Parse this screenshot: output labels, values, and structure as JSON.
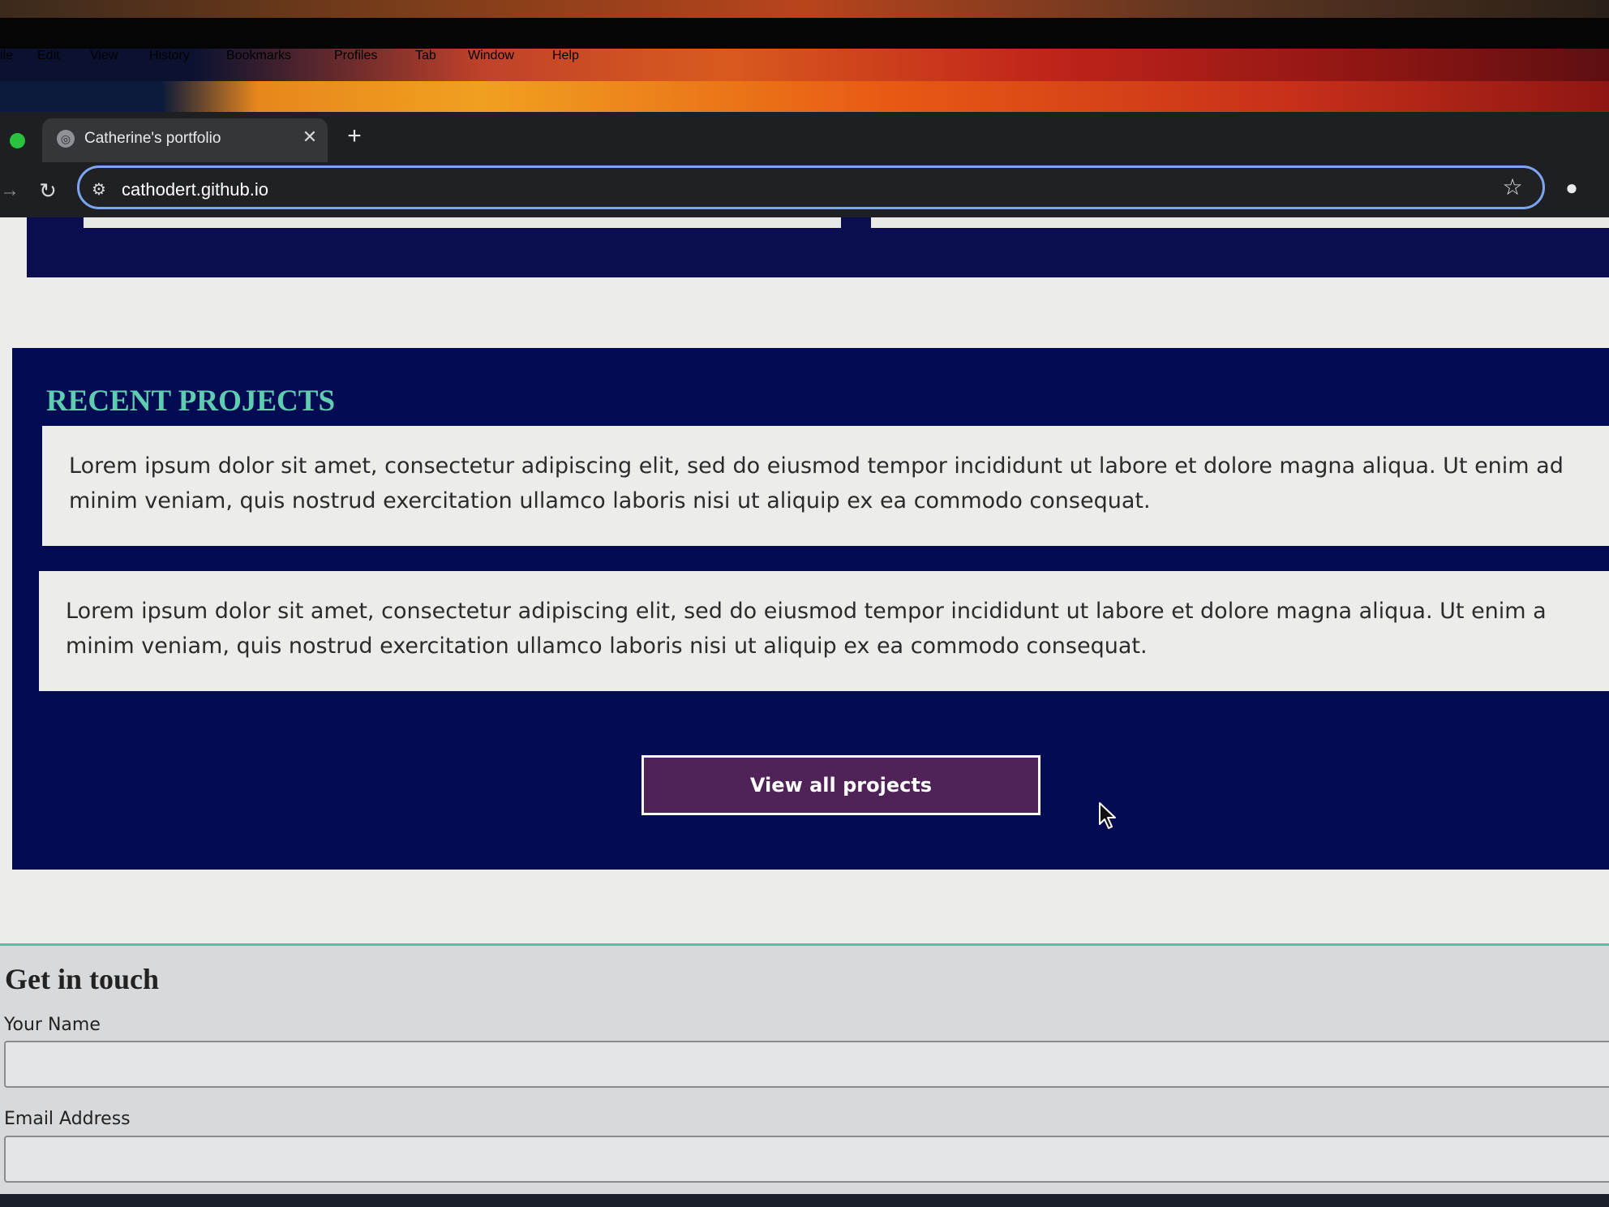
{
  "menubar": {
    "items": [
      "ile",
      "Edit",
      "View",
      "History",
      "Bookmarks",
      "Profiles",
      "Tab",
      "Window",
      "Help"
    ]
  },
  "browser": {
    "tab_title": "Catherine's portfolio",
    "tab_close_glyph": "✕",
    "new_tab_glyph": "+",
    "url": "cathodert.github.io",
    "icons": {
      "forward": "→",
      "reload": "↻",
      "site_info": "⚙",
      "bookmark": "☆",
      "profile": "●"
    }
  },
  "projects": {
    "heading": "RECENT PROJECTS",
    "cards": [
      {
        "line1": "Lorem ipsum dolor sit amet, consectetur adipiscing elit, sed do eiusmod tempor incididunt ut labore et dolore magna aliqua. Ut enim ad",
        "line2": "minim veniam, quis nostrud exercitation ullamco laboris nisi ut aliquip ex ea commodo consequat."
      },
      {
        "line1": "Lorem ipsum dolor sit amet, consectetur adipiscing elit, sed do eiusmod tempor incididunt ut labore et dolore magna aliqua. Ut enim a",
        "line2": "minim veniam, quis nostrud exercitation ullamco laboris nisi ut aliquip ex ea commodo consequat."
      }
    ],
    "view_all_label": "View all projects"
  },
  "contact": {
    "heading": "Get in touch",
    "name_label": "Your Name",
    "email_label": "Email Address"
  }
}
